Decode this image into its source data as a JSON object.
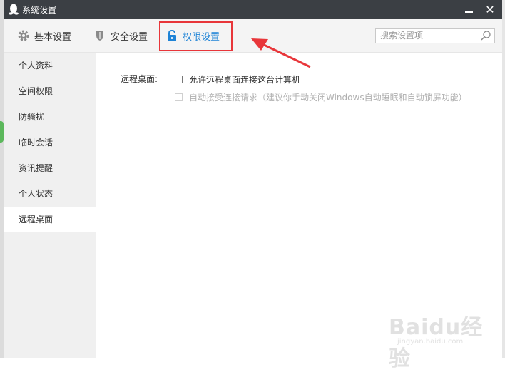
{
  "window": {
    "title": "系统设置",
    "close_symbol": "✕"
  },
  "tabs": [
    {
      "label": "基本设置",
      "icon": "gear-icon"
    },
    {
      "label": "安全设置",
      "icon": "shield-icon"
    },
    {
      "label": "权限设置",
      "icon": "lock-icon",
      "active": true
    }
  ],
  "search": {
    "placeholder": "搜索设置项"
  },
  "sidebar": {
    "items": [
      {
        "label": "个人资料"
      },
      {
        "label": "空间权限"
      },
      {
        "label": "防骚扰"
      },
      {
        "label": "临时会话"
      },
      {
        "label": "资讯提醒"
      },
      {
        "label": "个人状态"
      },
      {
        "label": "远程桌面",
        "active": true
      }
    ]
  },
  "main": {
    "section_label": "远程桌面:",
    "option_allow": "允许远程桌面连接这台计算机",
    "option_auto": "自动接受连接请求（建议你手动关闭Windows自动睡眠和自动锁屏功能）"
  },
  "watermark": {
    "text": "Baidu经验",
    "url": "jingyan.baidu.com"
  },
  "colors": {
    "titlebar": "#3b3f44",
    "accent": "#1e83d6",
    "annotation": "#e8363a"
  }
}
